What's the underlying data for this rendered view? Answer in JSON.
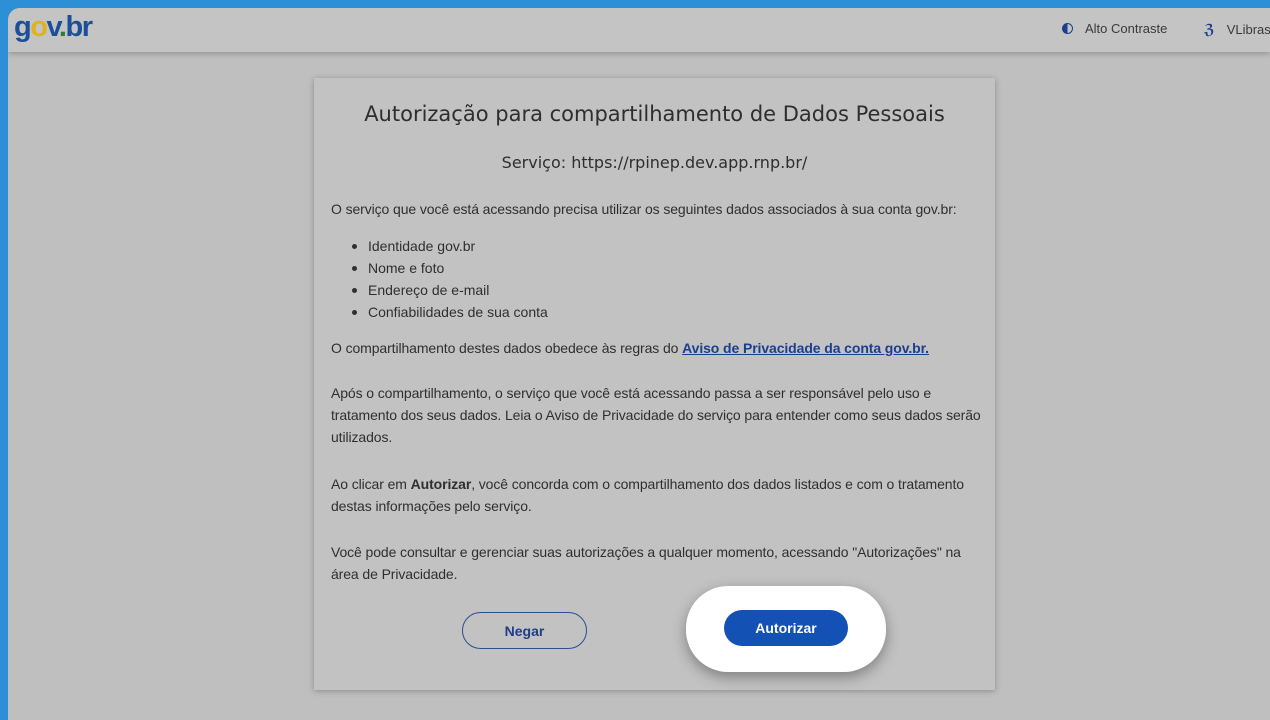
{
  "header": {
    "logo": {
      "g": "g",
      "o": "o",
      "v": "v",
      "dot": ".",
      "br": "br"
    },
    "alto_contraste": "Alto Contraste",
    "vlibras": "VLibras"
  },
  "card": {
    "title": "Autorização para compartilhamento de Dados Pessoais",
    "service": "Serviço: https://rpinep.dev.app.rnp.br/",
    "intro": "O serviço que você está acessando precisa utilizar os seguintes dados associados à sua conta gov.br:",
    "items": [
      "Identidade gov.br",
      "Nome e foto",
      "Endereço de e-mail",
      "Confiabilidades de sua conta"
    ],
    "privacy_prefix": "O compartilhamento destes dados obedece às regras do ",
    "privacy_link": "Aviso de Privacidade da conta gov.br.",
    "after_sharing": "Após o compartilhamento, o serviço que você está acessando passa a ser responsável pelo uso e tratamento dos seus dados. Leia o Aviso de Privacidade do serviço para entender como seus dados serão utilizados.",
    "consent_prefix": "Ao clicar em ",
    "consent_bold": "Autorizar",
    "consent_suffix": ", você concorda com o compartilhamento dos dados listados e com o tratamento destas informações pelo serviço.",
    "manage": "Você pode consultar e gerenciar suas autorizações a qualquer momento, acessando \"Autorizações\" na área de Privacidade.",
    "deny_label": "Negar",
    "authorize_label": "Autorizar"
  },
  "colors": {
    "primary_button": "#1351b4",
    "link": "#1a3f8f",
    "logo_blue": "#1b4f99",
    "logo_yellow": "#e0b21d"
  },
  "icons": {
    "contrast": "contrast-icon",
    "vlibras": "vlibras-hand-icon"
  }
}
